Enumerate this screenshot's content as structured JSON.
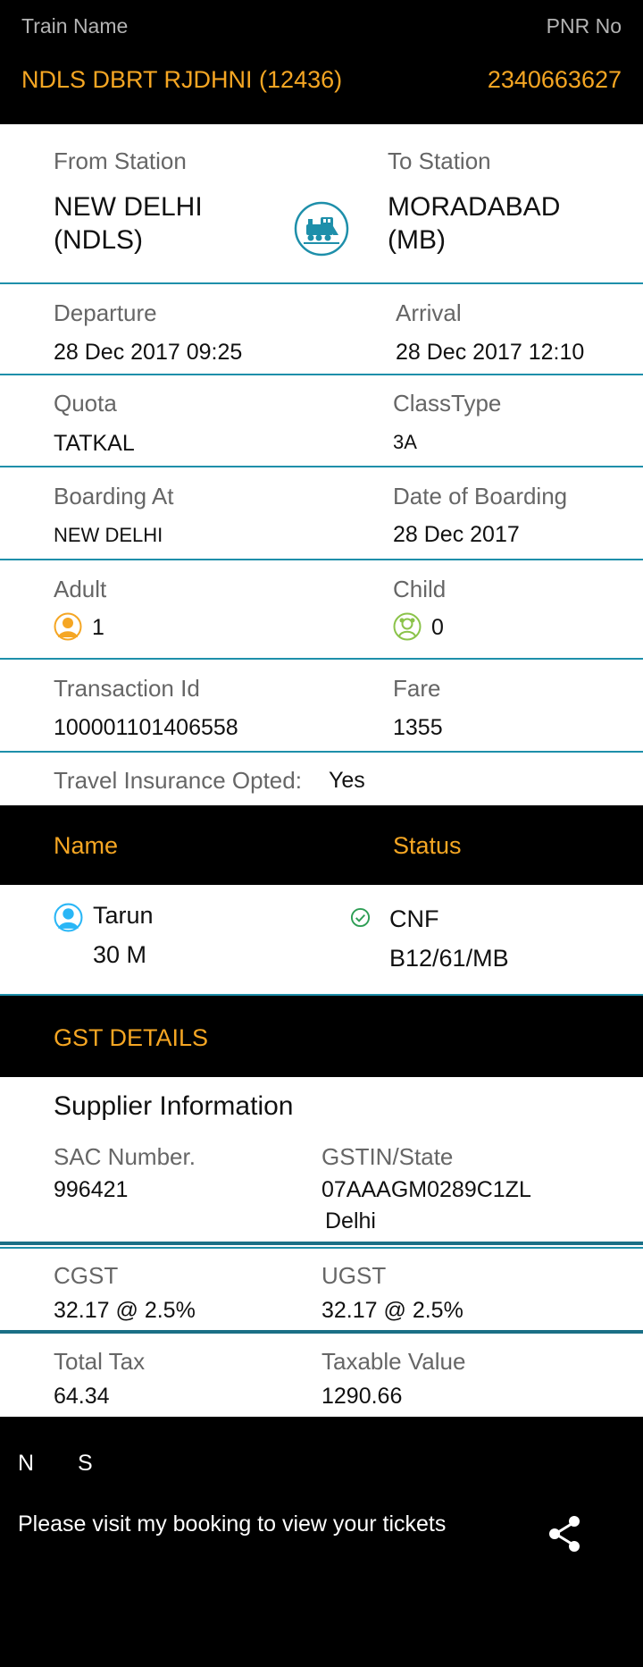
{
  "header": {
    "train_name_label": "Train Name",
    "pnr_label": "PNR No",
    "train_name": "NDLS DBRT RJDHNI (12436)",
    "pnr": "2340663627"
  },
  "journey": {
    "from_label": "From Station",
    "from_line1": "NEW DELHI",
    "from_line2": "(NDLS)",
    "to_label": "To Station",
    "to_line1": "MORADABAD",
    "to_line2": "(MB)",
    "departure_label": "Departure",
    "departure": "28 Dec 2017 09:25",
    "arrival_label": "Arrival",
    "arrival": "28 Dec 2017 12:10",
    "quota_label": "Quota",
    "quota": "TATKAL",
    "class_label": "ClassType",
    "class": "3A",
    "boarding_label": "Boarding At",
    "boarding": "NEW DELHI",
    "boarding_date_label": "Date of Boarding",
    "boarding_date": "28 Dec 2017",
    "adult_label": "Adult",
    "adult": "1",
    "child_label": "Child",
    "child": "0",
    "txn_label": "Transaction Id",
    "txn": "100001101406558",
    "fare_label": "Fare",
    "fare": "1355",
    "insurance_label": "Travel Insurance Opted:",
    "insurance": "Yes"
  },
  "passengers": {
    "name_header": "Name",
    "status_header": "Status",
    "items": [
      {
        "name": "Tarun",
        "detail": "30 M",
        "status": "CNF",
        "berth": "B12/61/MB"
      }
    ]
  },
  "gst": {
    "title": "GST DETAILS",
    "supplier_title": "Supplier Information",
    "sac_label": "SAC Number.",
    "sac": "996421",
    "gstin_label": "GSTIN/State",
    "gstin": "07AAAGM0289C1ZL",
    "state": "Delhi",
    "cgst_label": "CGST",
    "cgst": "32.17 @ 2.5%",
    "ugst_label": "UGST",
    "ugst": "32.17 @ 2.5%",
    "total_tax_label": "Total Tax",
    "total_tax": "64.34",
    "taxable_label": "Taxable Value",
    "taxable": "1290.66"
  },
  "footer": {
    "n": "N",
    "s": "S",
    "message": "Please visit my booking to view your tickets"
  },
  "colors": {
    "accent": "#f5a623",
    "separator": "#1e8faa",
    "adult_icon": "#f5a623",
    "child_icon": "#8bc34a",
    "passenger_icon": "#29b6f6",
    "status_icon": "#2e9e55",
    "train_icon": "#1e8faa"
  },
  "icons": {
    "train": "train-icon",
    "adult": "adult-icon",
    "child": "child-icon",
    "passenger": "passenger-icon",
    "status": "check-circle-icon",
    "share": "share-icon"
  }
}
